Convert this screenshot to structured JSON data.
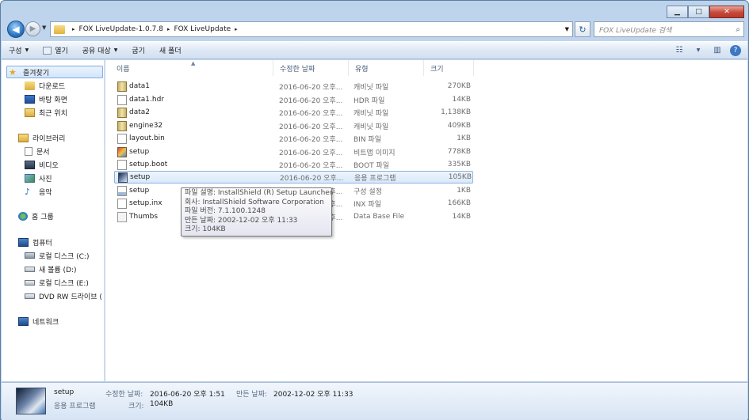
{
  "window": {
    "minimize": "▁",
    "maximize": "□",
    "close": "✕"
  },
  "address": {
    "segments": [
      "FOX LiveUpdate-1.0.7.8",
      "FOX LiveUpdate"
    ],
    "separator": "▸"
  },
  "search": {
    "placeholder": "FOX LiveUpdate 검색"
  },
  "toolbar": {
    "organize": "구성",
    "open": "열기",
    "share": "공유 대상",
    "burn": "굽기",
    "new_folder": "새 폴더"
  },
  "nav": {
    "favorites": "즐겨찾기",
    "downloads": "다운로드",
    "desktop": "바탕 화면",
    "recent": "최근 위치",
    "libraries": "라이브러리",
    "documents": "문서",
    "videos": "비디오",
    "pictures": "사진",
    "music": "음악",
    "homegroup": "홈 그룹",
    "computer": "컴퓨터",
    "drive_c": "로컬 디스크 (C:)",
    "drive_d": "새 볼륨 (D:)",
    "drive_e": "로컬 디스크 (E:)",
    "dvd": "DVD RW 드라이브 (",
    "network": "네트워크"
  },
  "columns": {
    "name": "이름",
    "date": "수정한 날짜",
    "type": "유형",
    "size": "크기"
  },
  "files": [
    {
      "name": "data1",
      "date": "2016-06-20 오후...",
      "type": "캐비닛 파일",
      "size": "270KB",
      "icon": "cab"
    },
    {
      "name": "data1.hdr",
      "date": "2016-06-20 오후...",
      "type": "HDR 파일",
      "size": "14KB",
      "icon": "doc"
    },
    {
      "name": "data2",
      "date": "2016-06-20 오후...",
      "type": "캐비닛 파일",
      "size": "1,138KB",
      "icon": "cab"
    },
    {
      "name": "engine32",
      "date": "2016-06-20 오후...",
      "type": "캐비닛 파일",
      "size": "409KB",
      "icon": "cab"
    },
    {
      "name": "layout.bin",
      "date": "2016-06-20 오후...",
      "type": "BIN 파일",
      "size": "1KB",
      "icon": "doc"
    },
    {
      "name": "setup",
      "date": "2016-06-20 오후...",
      "type": "비트맵 이미지",
      "size": "778KB",
      "icon": "bmp"
    },
    {
      "name": "setup.boot",
      "date": "2016-06-20 오후...",
      "type": "BOOT 파일",
      "size": "335KB",
      "icon": "doc"
    },
    {
      "name": "setup",
      "date": "2016-06-20 오후...",
      "type": "응용 프로그램",
      "size": "105KB",
      "icon": "exe"
    },
    {
      "name": "setup",
      "date": "2016-06-20 오후...",
      "type": "구성 설정",
      "size": "1KB",
      "icon": "ini"
    },
    {
      "name": "setup.inx",
      "date": "2016-06-20 오후...",
      "type": "INX 파일",
      "size": "166KB",
      "icon": "doc"
    },
    {
      "name": "Thumbs",
      "date": "2016-06-20 오후...",
      "type": "Data Base File",
      "size": "14KB",
      "icon": "db"
    }
  ],
  "tooltip": {
    "line1": "파일 설명: InstallShield (R) Setup Launcher",
    "line2": "회사: InstallShield Software Corporation",
    "line3": "파일 버전: 7.1.100.1248",
    "line4": "만든 날짜: 2002-12-02 오후 11:33",
    "line5": "크기: 104KB"
  },
  "details": {
    "name": "setup",
    "type": "응용 프로그램",
    "modified_label": "수정한 날짜:",
    "modified_value": "2016-06-20 오후 1:51",
    "created_label": "만든 날짜:",
    "created_value": "2002-12-02 오후 11:33",
    "size_label": "크기:",
    "size_value": "104KB"
  }
}
